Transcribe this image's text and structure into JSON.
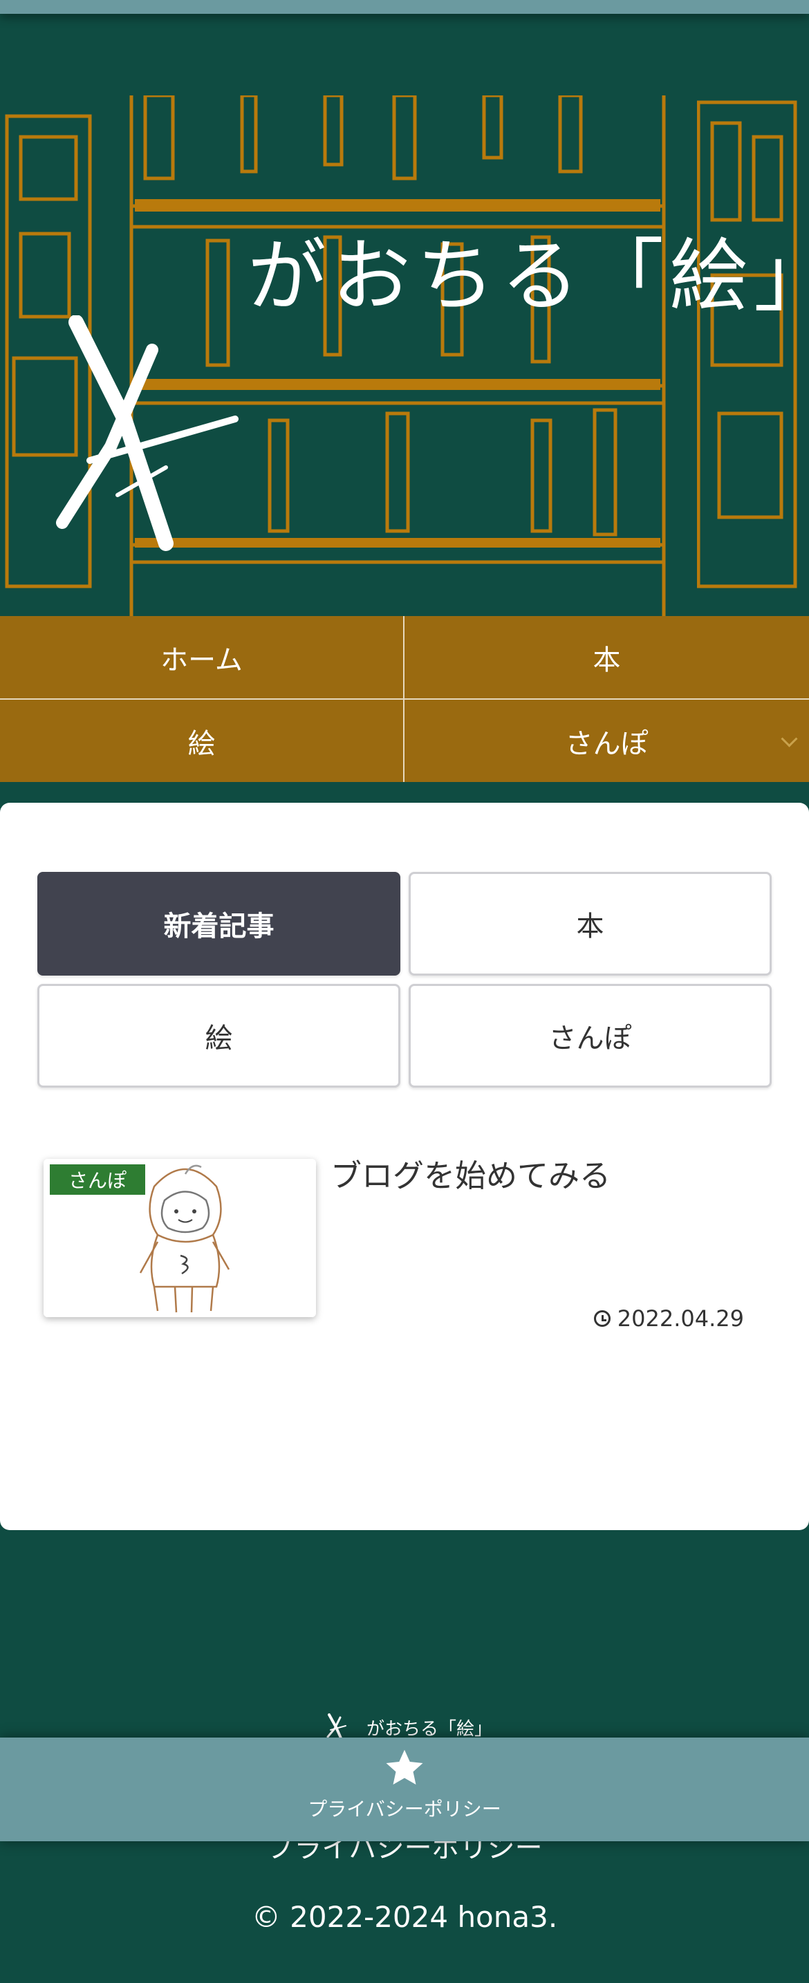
{
  "site": {
    "title": "がおちる「絵」",
    "logo_alt": "X"
  },
  "global_nav": {
    "items": [
      {
        "label": "ホーム"
      },
      {
        "label": "本"
      },
      {
        "label": "絵"
      },
      {
        "label": "さんぽ",
        "has_dropdown": true
      }
    ]
  },
  "tabs": {
    "items": [
      {
        "label": "新着記事",
        "active": true
      },
      {
        "label": "本",
        "active": false
      },
      {
        "label": "絵",
        "active": false
      },
      {
        "label": "さんぽ",
        "active": false
      }
    ]
  },
  "posts": [
    {
      "category": "さんぽ",
      "title": "ブログを始めてみる",
      "date": "2022.04.29"
    }
  ],
  "footer": {
    "site_name": "がおちる「絵」",
    "privacy_link": "プライバシーポリシー",
    "copyright": "© 2022-2024 hona3."
  },
  "floating_bar": {
    "label": "プライバシーポリシー",
    "icon": "star-icon"
  },
  "colors": {
    "background": "#0f4c42",
    "nav": "#9a6a10",
    "active_tab": "#41434f",
    "category_badge": "#2e7d32",
    "floating_bar": "#6b9aa0"
  }
}
